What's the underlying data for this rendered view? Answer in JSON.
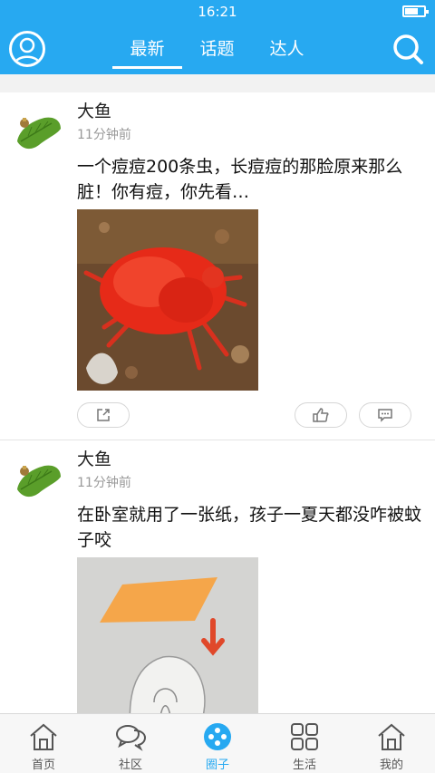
{
  "status_bar": {
    "time": "16:21"
  },
  "header": {
    "tabs": [
      {
        "label": "最新",
        "active": true
      },
      {
        "label": "话题",
        "active": false
      },
      {
        "label": "达人",
        "active": false
      }
    ],
    "avatar_icon": "user-icon",
    "search_icon": "search-icon"
  },
  "posts": [
    {
      "author": "大鱼",
      "time": "11分钟前",
      "title": "一个痘痘200条虫，长痘痘的那脸原来那么脏！你有痘，你先看…"
    },
    {
      "author": "大鱼",
      "time": "11分钟前",
      "title": "在卧室就用了一张纸，孩子一夏天都没咋被蚊子咬"
    }
  ],
  "tabbar": {
    "items": [
      {
        "label": "首页",
        "icon": "home-icon",
        "active": false
      },
      {
        "label": "社区",
        "icon": "chat-icon",
        "active": false
      },
      {
        "label": "圈子",
        "icon": "circle-icon",
        "active": true
      },
      {
        "label": "生活",
        "icon": "grid-icon",
        "active": false
      },
      {
        "label": "我的",
        "icon": "home-icon",
        "active": false
      }
    ]
  },
  "colors": {
    "accent": "#27a9f1",
    "divider": "#e4e4e4",
    "muted": "#999999"
  }
}
